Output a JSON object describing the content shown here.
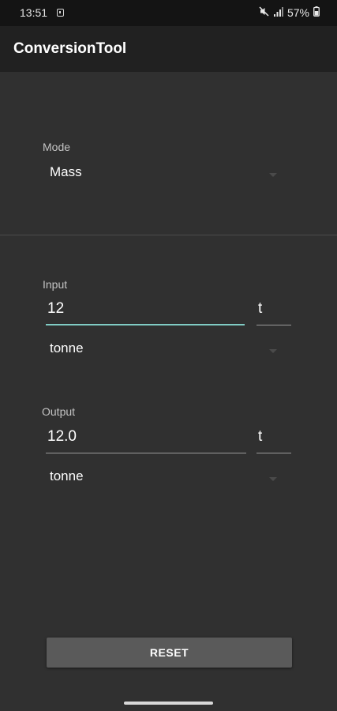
{
  "status_bar": {
    "time": "13:51",
    "battery": "57%",
    "icons": [
      "notification-icon",
      "mute-icon",
      "signal-icon",
      "battery-icon"
    ]
  },
  "app_bar": {
    "title": "ConversionTool"
  },
  "mode": {
    "label": "Mode",
    "selected": "Mass"
  },
  "input": {
    "label": "Input",
    "value": "12",
    "unit_symbol": "t",
    "unit": "tonne"
  },
  "output": {
    "label": "Output",
    "value": "12.0",
    "unit_symbol": "t",
    "unit": "tonne"
  },
  "reset_button": {
    "label": "RESET"
  },
  "colors": {
    "background": "#303030",
    "app_bar": "#212121",
    "status_bar": "#141414",
    "accent": "#80cbc4",
    "button": "#5a5a5a"
  }
}
